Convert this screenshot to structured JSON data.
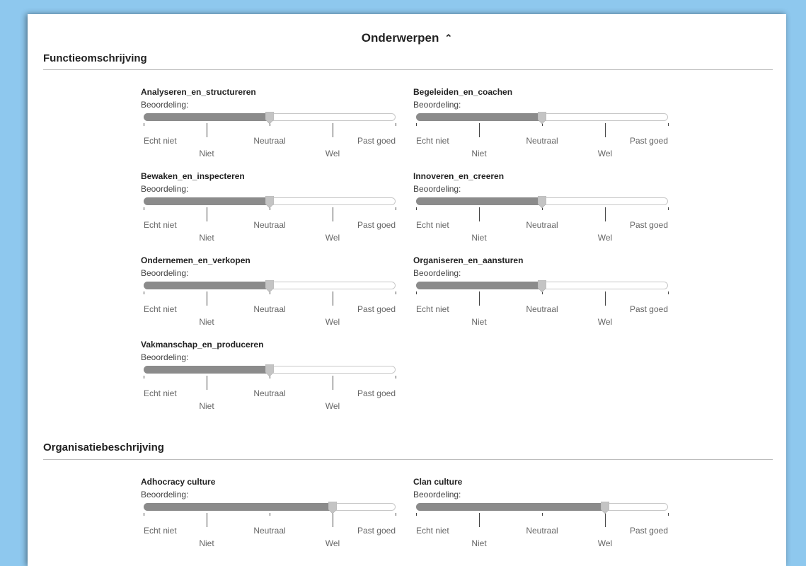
{
  "header": {
    "title": "Onderwerpen"
  },
  "common": {
    "rating_label": "Beoordeling:",
    "scale": [
      "Echt niet",
      "Niet",
      "Neutraal",
      "Wel",
      "Past goed"
    ]
  },
  "colors": {
    "background": "#8ec8ee",
    "slider_fill": "#8b8b8b",
    "slider_thumb": "#c4c4c4",
    "track_border": "#c8c8c8"
  },
  "sections": [
    {
      "heading": "Functieomschrijving",
      "items": [
        {
          "name": "Analyseren_en_structureren",
          "value": 0.5
        },
        {
          "name": "Begeleiden_en_coachen",
          "value": 0.5
        },
        {
          "name": "Bewaken_en_inspecteren",
          "value": 0.5
        },
        {
          "name": "Innoveren_en_creeren",
          "value": 0.5
        },
        {
          "name": "Ondernemen_en_verkopen",
          "value": 0.5
        },
        {
          "name": "Organiseren_en_aansturen",
          "value": 0.5
        },
        {
          "name": "Vakmanschap_en_produceren",
          "value": 0.5
        }
      ]
    },
    {
      "heading": "Organisatiebeschrijving",
      "items": [
        {
          "name": "Adhocracy culture",
          "value": 0.75
        },
        {
          "name": "Clan culture",
          "value": 0.75
        }
      ]
    }
  ]
}
